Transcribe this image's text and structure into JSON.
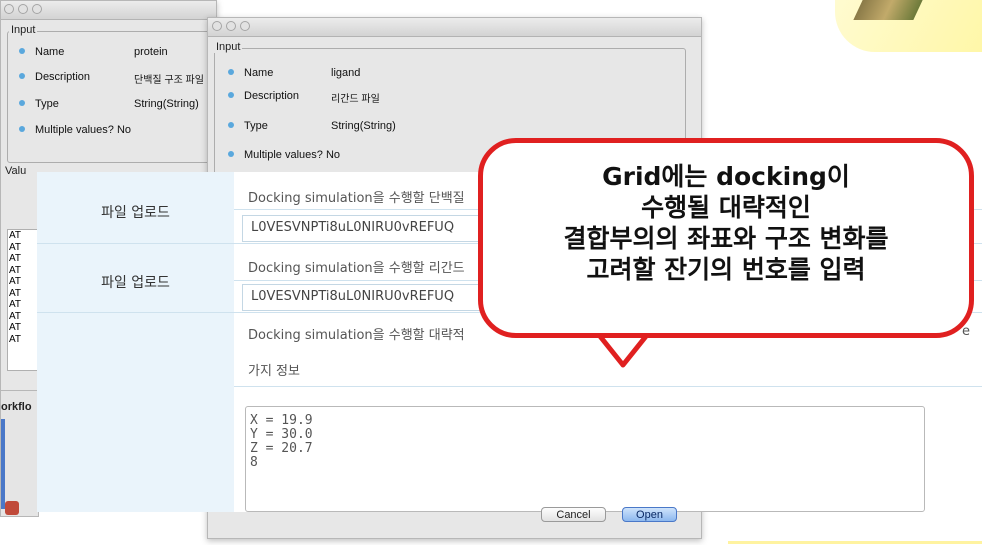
{
  "window_protein": {
    "group_input": "Input",
    "fields": [
      {
        "label": "Name",
        "value": "protein"
      },
      {
        "label": "Description",
        "value": "단백질 구조 파일"
      },
      {
        "label": "Type",
        "value": "String(String)"
      },
      {
        "label": "Multiple values?",
        "value": "No"
      }
    ],
    "group_values": "Valu",
    "list_items": [
      "AT",
      "AT",
      "AT",
      "AT",
      "AT",
      "AT",
      "AT",
      "AT",
      "AT",
      "AT"
    ],
    "workflow_fragment": "orkflo"
  },
  "window_ligand": {
    "group_input": "Input",
    "fields": [
      {
        "label": "Name",
        "value": "ligand"
      },
      {
        "label": "Description",
        "value": "리간드 파일"
      },
      {
        "label": "Type",
        "value": "String(String)"
      },
      {
        "label": "Multiple values?",
        "value": "No"
      }
    ]
  },
  "form": {
    "rows": [
      {
        "label": "파일 업로드",
        "description": "Docking simulation을 수행할 단백질",
        "file_value": "L0VESVNPTi8uL0NIRU0vREFUQ"
      },
      {
        "label": "파일 업로드",
        "description": "Docking simulation을 수행할 리간드",
        "file_value": "L0VESVNPTi8uL0NIRU0vREFUQ"
      }
    ],
    "grid_description_line1": "Docking simulation을 수행할 대략적",
    "grid_description_line1_tail": "e",
    "grid_description_line2": "가지 정보",
    "grid_values": "X = 19.9\nY = 30.0\nZ = 20.7\n8"
  },
  "dialog_buttons": {
    "cancel": "Cancel",
    "open": "Open"
  },
  "callout": {
    "lines": [
      "Grid에는 docking이",
      "수행될 대략적인",
      "결합부의의 좌표와 구조 변화를",
      "고려할 잔기의 번호를 입력"
    ],
    "border_color": "#e02020"
  }
}
